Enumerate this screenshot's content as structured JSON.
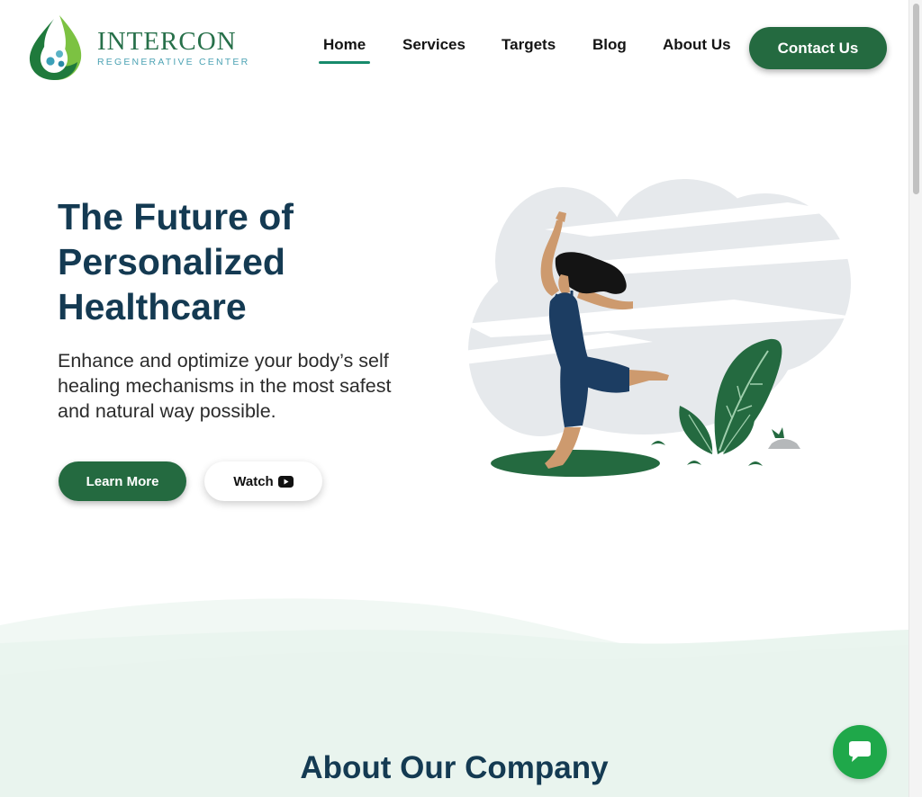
{
  "brand": {
    "name": "INTERCON",
    "subtitle": "REGENERATIVE CENTER",
    "colors": {
      "primary": "#246a40",
      "heading": "#143a52",
      "accent": "#178a6b",
      "logo_teal": "#4da3b4",
      "chat": "#1fa84a"
    }
  },
  "nav": {
    "items": [
      {
        "label": "Home",
        "active": true
      },
      {
        "label": "Services",
        "active": false
      },
      {
        "label": "Targets",
        "active": false
      },
      {
        "label": "Blog",
        "active": false
      },
      {
        "label": "About Us",
        "active": false
      }
    ],
    "contact_label": "Contact Us"
  },
  "hero": {
    "title_lines": [
      "The Future of",
      "Personalized",
      "Healthcare"
    ],
    "text_lines": [
      "Enhance and optimize your body’s self",
      "healing mechanisms in the most safest",
      "and natural way possible."
    ],
    "learn_more_label": "Learn More",
    "watch_label": "Watch",
    "watch_icon": "youtube-play-icon",
    "illustration": "dancing-woman-with-plants"
  },
  "about": {
    "title": "About Our Company"
  },
  "chat": {
    "icon": "chat-bubble-icon"
  }
}
